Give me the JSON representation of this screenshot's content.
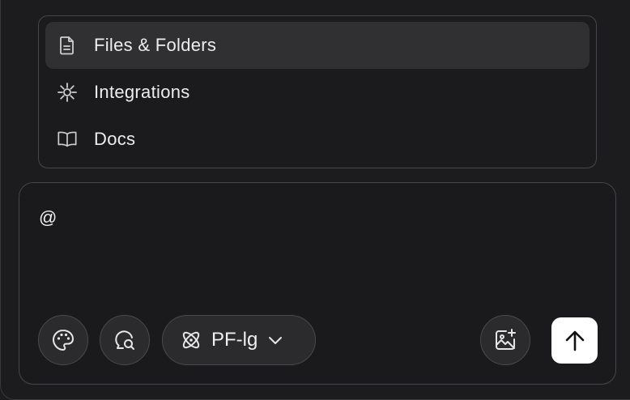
{
  "mention_menu": {
    "items": [
      {
        "label": "Files & Folders",
        "icon": "file-icon",
        "selected": true
      },
      {
        "label": "Integrations",
        "icon": "integrations-icon",
        "selected": false
      },
      {
        "label": "Docs",
        "icon": "book-icon",
        "selected": false
      }
    ]
  },
  "composer": {
    "input_value": "@",
    "model_selector": {
      "label": "PF-lg",
      "icon": "atom-icon"
    },
    "buttons": [
      "palette-icon",
      "search-chat-icon",
      "image-add-icon",
      "arrow-up-icon"
    ]
  },
  "colors": {
    "background": "#1c1c1e",
    "selected_item": "#303033",
    "send_button": "#ffffff"
  }
}
